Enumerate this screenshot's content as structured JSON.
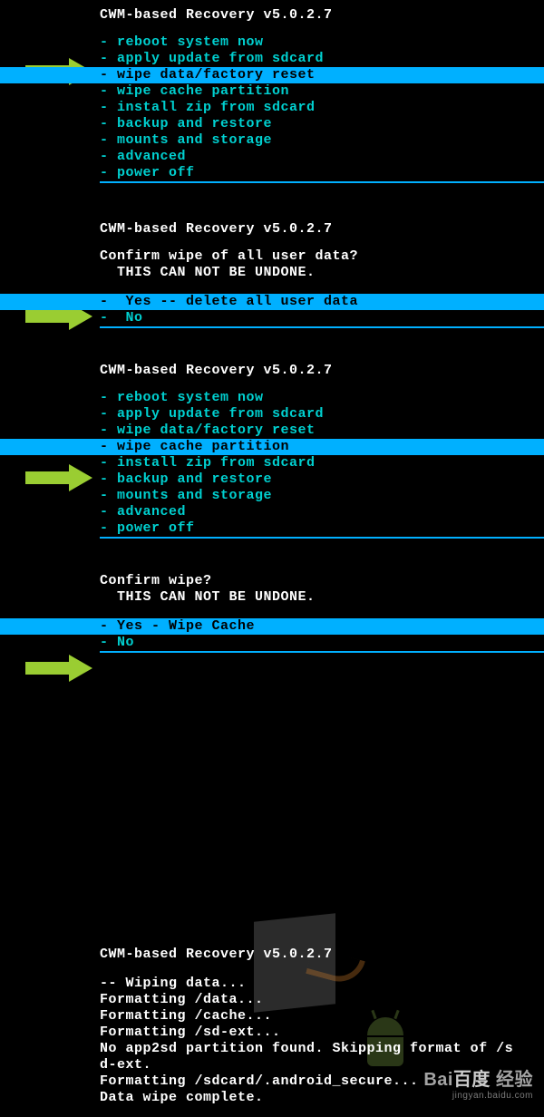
{
  "recovery_title": "CWM-based Recovery v5.0.2.7",
  "menu1": {
    "items": [
      "- reboot system now",
      "- apply update from sdcard",
      "- wipe data/factory reset",
      "- wipe cache partition",
      "- install zip from sdcard",
      "- backup and restore",
      "- mounts and storage",
      "- advanced",
      "- power off"
    ],
    "selected_index": 2
  },
  "confirm1": {
    "prompt_line1": "Confirm wipe of all user data?",
    "prompt_line2": "  THIS CAN NOT BE UNDONE.",
    "items": [
      "-  Yes -- delete all user data",
      "-  No"
    ],
    "selected_index": 0
  },
  "menu2": {
    "items": [
      "- reboot system now",
      "- apply update from sdcard",
      "- wipe data/factory reset",
      "- wipe cache partition",
      "- install zip from sdcard",
      "- backup and restore",
      "- mounts and storage",
      "- advanced",
      "- power off"
    ],
    "selected_index": 3
  },
  "confirm2": {
    "prompt_line1": "Confirm wipe?",
    "prompt_line2": "  THIS CAN NOT BE UNDONE.",
    "items": [
      "- Yes - Wipe Cache",
      "- No"
    ],
    "selected_index": 0
  },
  "log": {
    "lines": [
      "-- Wiping data...",
      "Formatting /data...",
      "Formatting /cache...",
      "Formatting /sd-ext...",
      "No app2sd partition found. Skipping format of /s",
      "d-ext.",
      "Formatting /sdcard/.android_secure...",
      "Data wipe complete."
    ]
  },
  "watermark": {
    "brand": "Bai",
    "brand_cn": "百度",
    "suffix": "经验",
    "url": "jingyan.baidu.com"
  }
}
